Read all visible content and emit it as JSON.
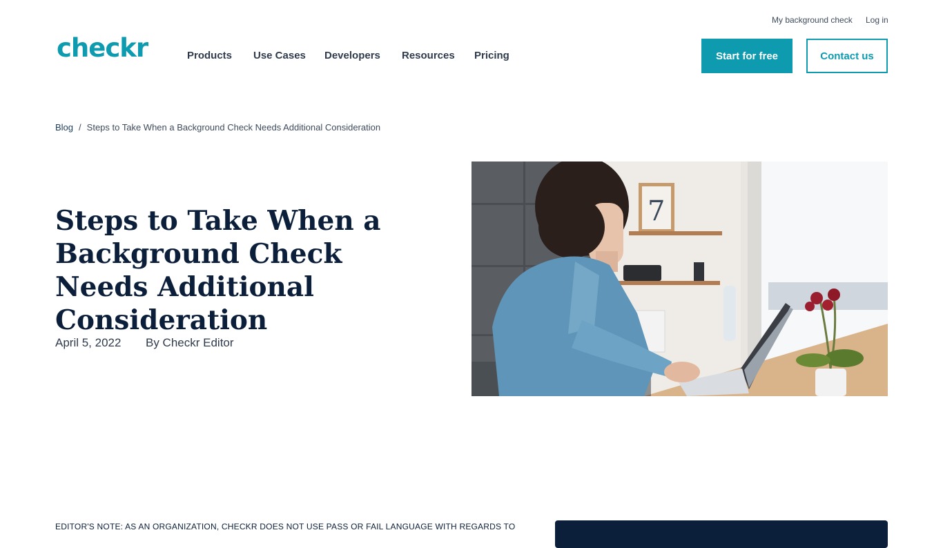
{
  "brand": {
    "logo_text": "checkr",
    "color": "#0e9bb0"
  },
  "utility_nav": {
    "my_background_check": "My background check",
    "log_in": "Log in"
  },
  "nav": {
    "items": [
      {
        "label": "Products"
      },
      {
        "label": "Use Cases"
      },
      {
        "label": "Developers"
      },
      {
        "label": "Resources"
      },
      {
        "label": "Pricing"
      }
    ]
  },
  "header_buttons": {
    "start_free": "Start for free",
    "contact": "Contact us"
  },
  "breadcrumb": {
    "blog": "Blog",
    "separator": "/",
    "current": "Steps to Take When a Background Check Needs Additional Consideration"
  },
  "article": {
    "title": "Steps to Take When a Background Check Needs Additional Consideration",
    "date": "April 5, 2022",
    "author": "By Checkr Editor",
    "hero_image": "woman-typing-on-laptop-photo",
    "editors_note": "EDITOR'S NOTE: AS AN ORGANIZATION, CHECKR DOES NOT USE PASS OR FAIL LANGUAGE WITH REGARDS TO"
  },
  "colors": {
    "primary": "#0e9bb0",
    "navy": "#0b1f3a",
    "text": "#2f3b4c"
  }
}
